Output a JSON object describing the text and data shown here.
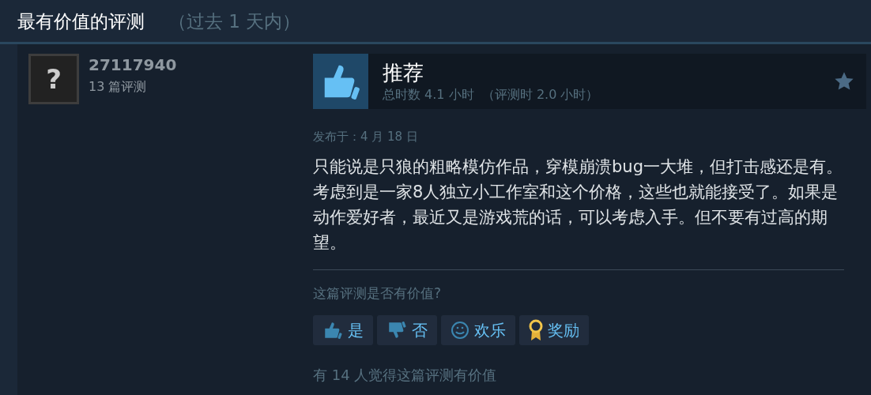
{
  "section": {
    "title": "最有价值的评测",
    "period": "（过去 1 天内）"
  },
  "review": {
    "author": {
      "avatar_glyph": "?",
      "name": "27117940",
      "reviews_count": "13 篇评测"
    },
    "verdict": "推荐",
    "hours": "总时数 4.1 小时  （评测时 2.0 小时）",
    "posted": "发布于：4 月 18 日",
    "text": "只能说是只狼的粗略模仿作品，穿模崩溃bug一大堆，但打击感还是有。考虑到是一家8人独立小工作室和这个价格，这些也就能接受了。如果是动作爱好者，最近又是游戏荒的话，可以考虑入手。但不要有过高的期望。",
    "question": "这篇评测是否有价值?",
    "buttons": [
      {
        "kind": "yes",
        "label": "是"
      },
      {
        "kind": "no",
        "label": "否"
      },
      {
        "kind": "funny",
        "label": "欢乐"
      },
      {
        "kind": "award",
        "label": "奖励"
      }
    ],
    "helpful": "有 14 人觉得这篇评测有价值"
  }
}
